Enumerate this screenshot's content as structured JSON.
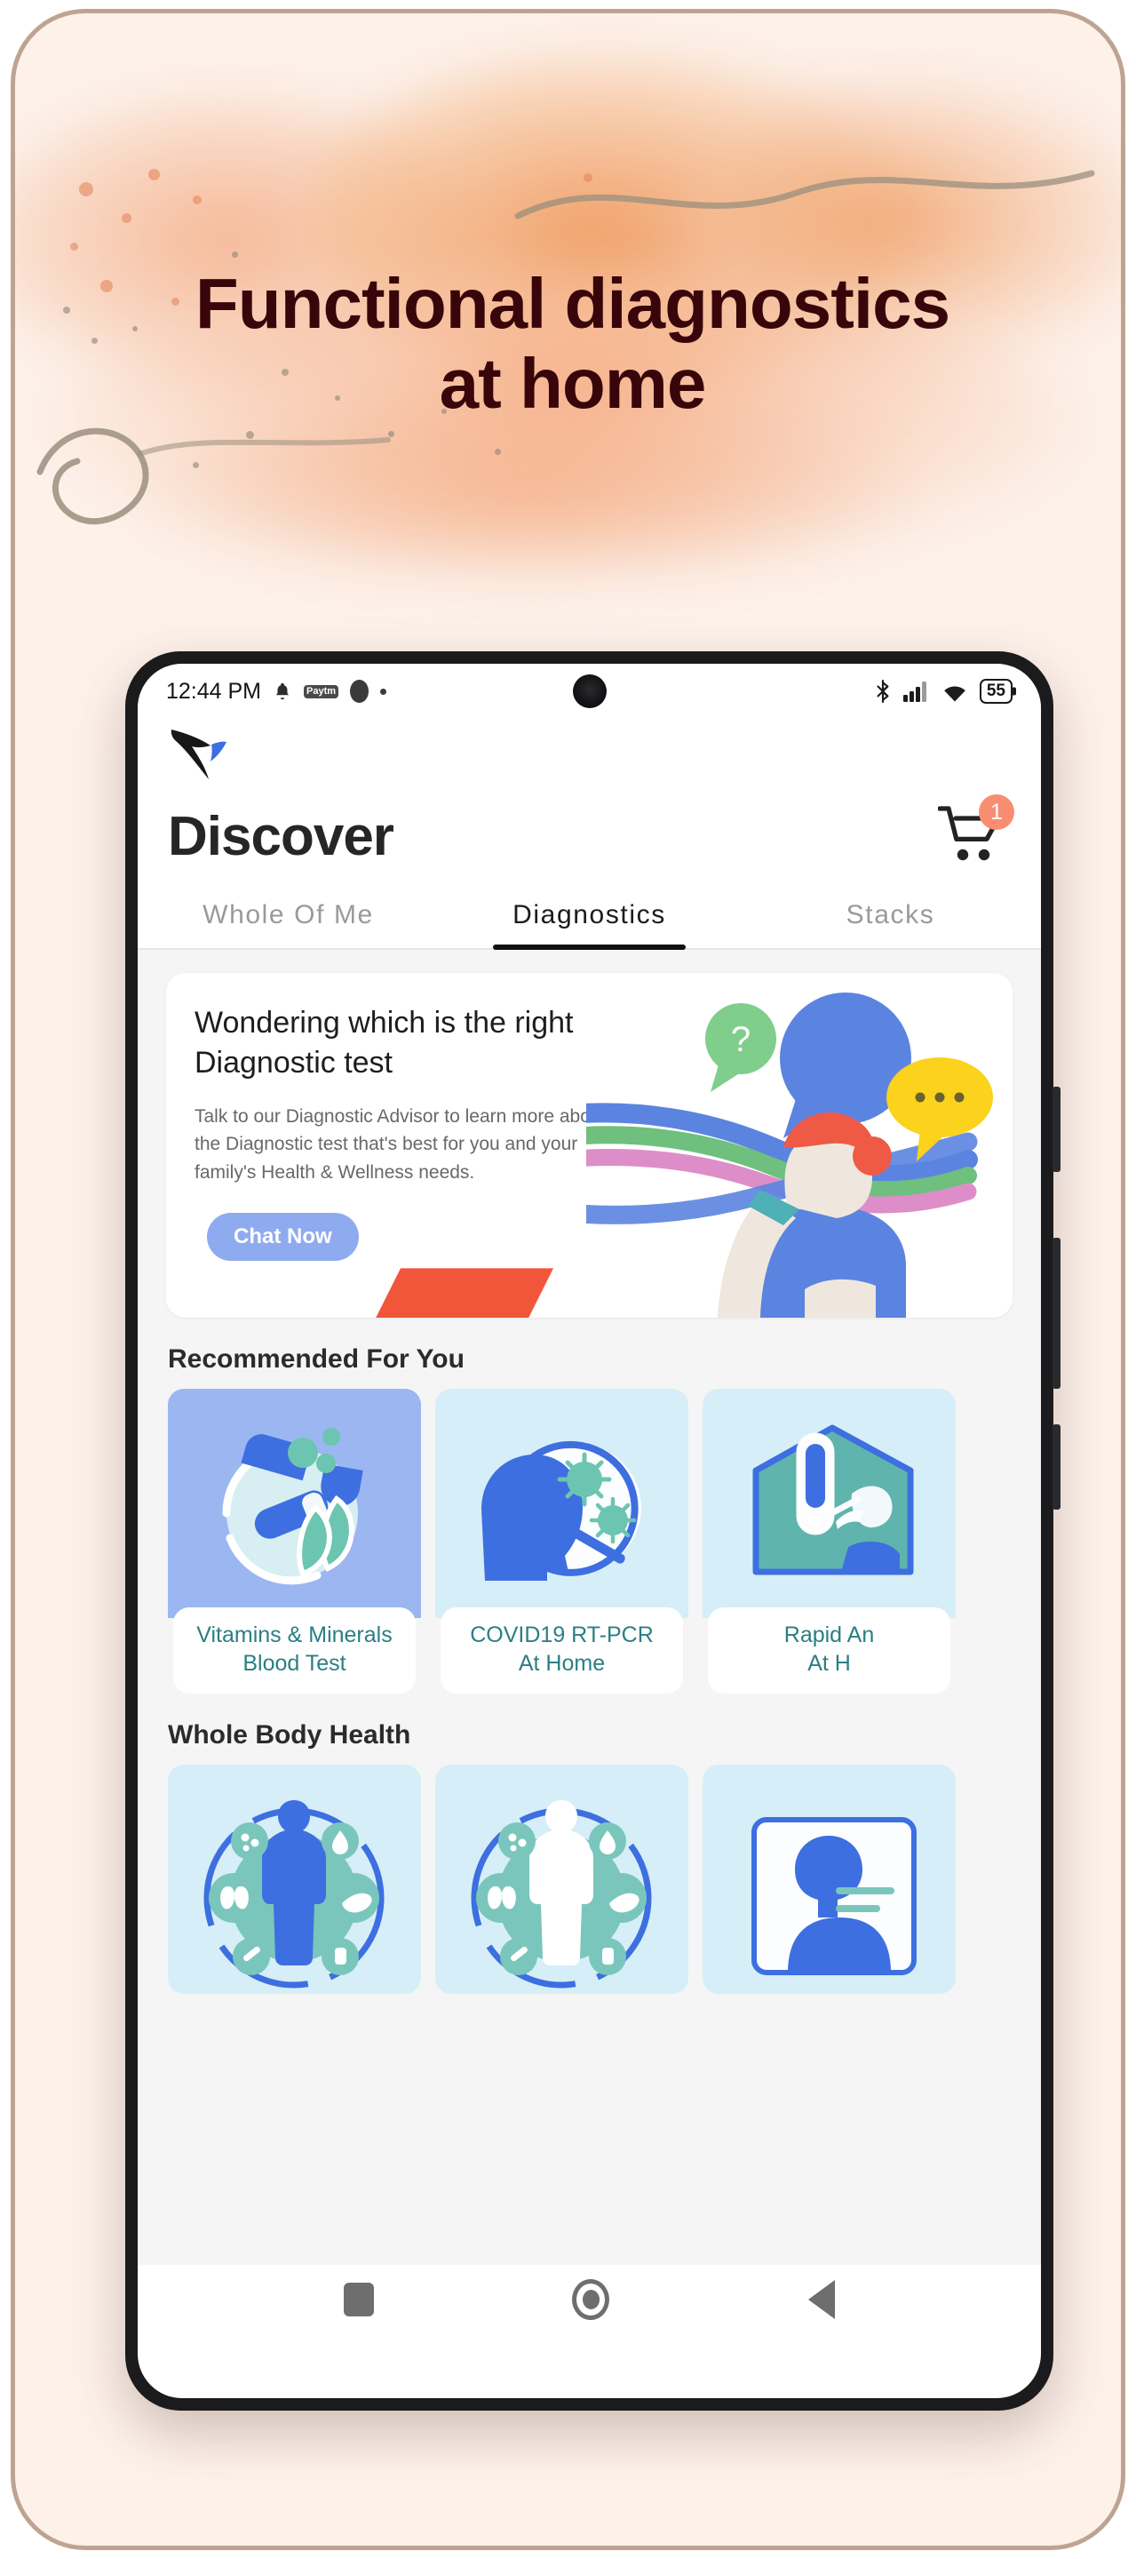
{
  "promo": {
    "headline": "Functional diagnostics\nat home",
    "background_color": "#fdf1ea",
    "headline_color": "#38060a",
    "border_color": "#bfa392",
    "splash_color": "#ef9b60"
  },
  "phone": {
    "status_bar": {
      "time": "12:44 PM",
      "bell_icon": "bell-icon",
      "paytm_label": "Paytm",
      "bluetooth_icon": "bluetooth-icon",
      "signal_icon": "cellular-signal-icon",
      "wifi_icon": "wifi-icon",
      "battery_level": "55"
    },
    "nav_bar": {
      "recents_label": "Recents",
      "home_label": "Home",
      "back_label": "Back"
    }
  },
  "app": {
    "logo_name": "hummingbird-logo",
    "page_title": "Discover",
    "cart": {
      "icon": "shopping-cart-icon",
      "badge_count": "1"
    },
    "tabs": [
      {
        "label": "Whole Of\nMe",
        "active": false
      },
      {
        "label": "Diagnostics",
        "active": true
      },
      {
        "label": "Stacks",
        "active": false
      }
    ],
    "advisor_card": {
      "title": "Wondering which is the right\nDiagnostic test",
      "description": "Talk to our Diagnostic Advisor to learn more about\nthe Diagnostic test that's best for you and your\nfamily's Health & Wellness needs.",
      "button_label": "Chat Now",
      "button_color": "#8fabf0",
      "illustration": "advisor-chat-illustration"
    },
    "sections": [
      {
        "heading": "Recommended For You",
        "cards": [
          {
            "label": "Vitamins & Minerals\nBlood Test",
            "art": "vitamins-minerals-icon",
            "bg": "#9cb6f2"
          },
          {
            "label": "COVID19 RT-PCR\nAt Home",
            "art": "covid-swab-icon",
            "bg": "#d6eef7"
          },
          {
            "label": "Rapid An\nAt H",
            "art": "rapid-antigen-icon",
            "bg": "#d6eef7"
          }
        ]
      },
      {
        "heading": "Whole Body Health",
        "cards": [
          {
            "label": "",
            "art": "whole-body-organs-icon",
            "bg": "#d6eef7"
          },
          {
            "label": "",
            "art": "whole-body-organs-light-icon",
            "bg": "#d6eef7"
          },
          {
            "label": "",
            "art": "seated-person-icon",
            "bg": "#d6eef7"
          }
        ]
      }
    ],
    "label_color": "#2a7f84"
  }
}
